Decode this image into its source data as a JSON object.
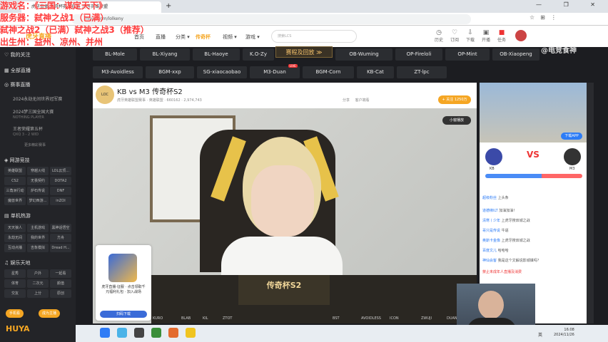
{
  "overlay": {
    "line1": "游戏名：《三国：谋定天下》",
    "line2": "服务器：弑神之战1（已满）",
    "line3": "弑神之战2（已满）弑神之战3（推荐）",
    "line4": "出生州：益州、凉州、并州"
  },
  "browser": {
    "tab_title": "虎牙直播-传奇杯赛事直播_虎牙英雄联盟",
    "url": "huya.com/lolkeny",
    "new_tab": "+",
    "window_controls": "—  ❐  ✕"
  },
  "site": {
    "logo": "虎牙直播",
    "nav": [
      "首页",
      "直播",
      "分类 ▾",
      "传奇杯",
      "视频 ▾",
      "游戏 ▾"
    ],
    "active_nav": "传奇杯",
    "search_placeholder": "搜索LCS",
    "header_icons": [
      {
        "icon": "history-icon",
        "label": "历史"
      },
      {
        "icon": "subscribe-icon",
        "label": "订阅"
      },
      {
        "icon": "download-icon",
        "label": "下载"
      },
      {
        "icon": "broadcast-icon",
        "label": "开播"
      },
      {
        "icon": "task-icon",
        "label": "任务"
      }
    ]
  },
  "sidebar": {
    "my_follow": "我的关注",
    "all_live": "全部直播",
    "events": "赛事直播",
    "event1": "2024永劫无间世界冠军赛",
    "event2": "2024梦三国全国大赛",
    "event2_sub": "NOTHING PLAYER",
    "event3": "王者荣耀第五杯",
    "event3_sub": "QXQ 3 - 2 WID",
    "more_events": "更多精彩赛事",
    "online_games": "网游竞技",
    "games_row1": [
      "英雄联盟",
      "穿越火线",
      "LOL云顶..."
    ],
    "games_row2": [
      "CS2",
      "无畏契约",
      "DOTA2"
    ],
    "games_row3": [
      "三角洲行动",
      "炉石传说",
      "DNF"
    ],
    "games_row4": [
      "魔兽世界",
      "梦幻西游...",
      "inZOI"
    ],
    "single_games": "单机热游",
    "single_row1": [
      "天天狼人",
      "主机游戏",
      "黑神话悟空"
    ],
    "single_row2": [
      "永劫无间",
      "我的世界",
      "方舟"
    ],
    "single_row3": [
      "互动点播",
      "吉象模拟",
      "Dread H..."
    ],
    "entertainment": "娱乐天地",
    "ent_row1": [
      "星秀",
      "户外",
      "一起看"
    ],
    "ent_row2": [
      "体育",
      "二次元",
      "颜值"
    ],
    "ent_row3": [
      "交友",
      "上分",
      "原创"
    ],
    "btn1": "手机看",
    "btn2": "成为主播",
    "bottom_logo": "HUYA"
  },
  "pills_row1": [
    "BL-Mole",
    "BL-Xiyang",
    "BL-Haoye",
    "K.O-Zy",
    "",
    "OB-Wuming",
    "OP-Fireloli",
    "OP-Mint",
    "OB-Xiaopeng"
  ],
  "pills_row2": [
    "M3-Avoidless",
    "BGM-xxp",
    "SG-xiaocaobao",
    "M3-Duan",
    "BGM-Corn",
    "KB-Cat",
    "ZT-lpc"
  ],
  "replay_button": "赛程及回放 ≫",
  "live_badge": "LIVE",
  "watermark": "@电竞食神",
  "room": {
    "logo": "LOC",
    "title": "KB vs M3 传奇杯S2",
    "meta": "虎牙英雄联盟赛事  ·  英雄联盟  ·  660162  ·  2,974,743",
    "actions": "分享  客户端看",
    "follow": "+ 关注  1250万",
    "small_window": "小窗播放"
  },
  "promo": {
    "text": "虎牙直播·征服 · 点击领取千元福利礼包 · 加入战场",
    "button": "扫码下载"
  },
  "game_title": "传奇杯S2",
  "team_names": [
    "KURO",
    "BLAB",
    "KIL",
    "ZTOT",
    "BST",
    "AVOIDLESS",
    "ICON",
    "ZWUJI",
    "DUAN"
  ],
  "right": {
    "app_button": "下载APP",
    "vs": "VS",
    "team1": "KB",
    "team2": "M3",
    "vote_ratio": 0.58,
    "chats": [
      {
        "user": "超级粉丝",
        "text": "上头条"
      },
      {
        "user": "道德绑ILT",
        "text": "加油加油！"
      },
      {
        "user": "清寒丨少年",
        "text": "上虎牙搜双城之战"
      },
      {
        "user": "哥只是传说",
        "text": "牛逼"
      },
      {
        "user": "奥斯卡金像",
        "text": "上虎牙搜双城之战"
      },
      {
        "user": "百度文儿",
        "text": "哈哈哈"
      },
      {
        "user": "神仙会客",
        "text": "我是这个文解说影城镇吗？"
      },
      {
        "user": "系统",
        "text": "禁止未成年人直播及消费"
      }
    ]
  },
  "taskbar": {
    "lang": "英",
    "time": "16:08",
    "date": "2024/11/26"
  }
}
